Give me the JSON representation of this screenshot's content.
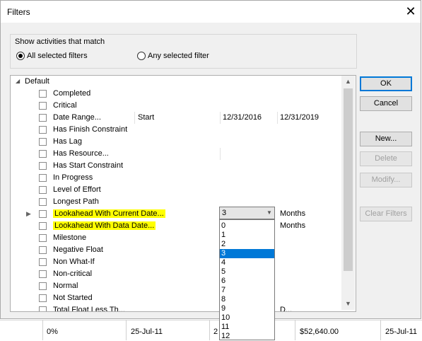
{
  "background_table": {
    "cells": [
      "0%",
      "25-Jul-11",
      "2",
      "$52,640.00",
      "25-Jul-11"
    ]
  },
  "dialog": {
    "title": "Filters",
    "match_group_label": "Show activities that match",
    "radio_all": "All selected filters",
    "radio_any": "Any selected filter",
    "tree_root": "Default",
    "filters": [
      {
        "label": "Completed",
        "c2": "",
        "c3": "",
        "c4": ""
      },
      {
        "label": "Critical",
        "c2": "",
        "c3": "",
        "c4": ""
      },
      {
        "label": "Date Range...",
        "c2": "Start",
        "c3": "12/31/2016",
        "c4": "12/31/2019"
      },
      {
        "label": "Has Finish Constraint",
        "c2": "",
        "c3": "",
        "c4": ""
      },
      {
        "label": "Has Lag",
        "c2": "",
        "c3": "",
        "c4": ""
      },
      {
        "label": "Has Resource...",
        "c2": "",
        "c3": "",
        "c4": ""
      },
      {
        "label": "Has Start Constraint",
        "c2": "",
        "c3": "",
        "c4": ""
      },
      {
        "label": "In Progress",
        "c2": "",
        "c3": "",
        "c4": ""
      },
      {
        "label": "Level of Effort",
        "c2": "",
        "c3": "",
        "c4": ""
      },
      {
        "label": "Longest Path",
        "c2": "",
        "c3": "",
        "c4": ""
      },
      {
        "label": "Lookahead With Current Date...",
        "c2": "",
        "c3": "",
        "c4": "Months"
      },
      {
        "label": "Lookahead With Data Date...",
        "c2": "",
        "c3": "",
        "c4": "Months"
      },
      {
        "label": "Milestone",
        "c2": "",
        "c3": "",
        "c4": ""
      },
      {
        "label": "Negative Float",
        "c2": "",
        "c3": "",
        "c4": ""
      },
      {
        "label": "Non What-If",
        "c2": "",
        "c3": "",
        "c4": ""
      },
      {
        "label": "Non-critical",
        "c2": "",
        "c3": "",
        "c4": ""
      },
      {
        "label": "Normal",
        "c2": "",
        "c3": "",
        "c4": ""
      },
      {
        "label": "Not Started",
        "c2": "",
        "c3": "",
        "c4": ""
      },
      {
        "label": "Total Float Less Th...",
        "c2": "",
        "c3": "",
        "c4": "D..."
      }
    ],
    "combo_value": "3",
    "dropdown_options": [
      "0",
      "1",
      "2",
      "3",
      "4",
      "5",
      "6",
      "7",
      "8",
      "9",
      "10",
      "11",
      "12"
    ],
    "dropdown_selected": "3",
    "buttons": {
      "ok": "OK",
      "cancel": "Cancel",
      "new": "New...",
      "delete": "Delete",
      "modify": "Modify...",
      "clear": "Clear Filters"
    },
    "colors": {
      "highlight": "#ffff00",
      "selection": "#0078d7"
    }
  }
}
